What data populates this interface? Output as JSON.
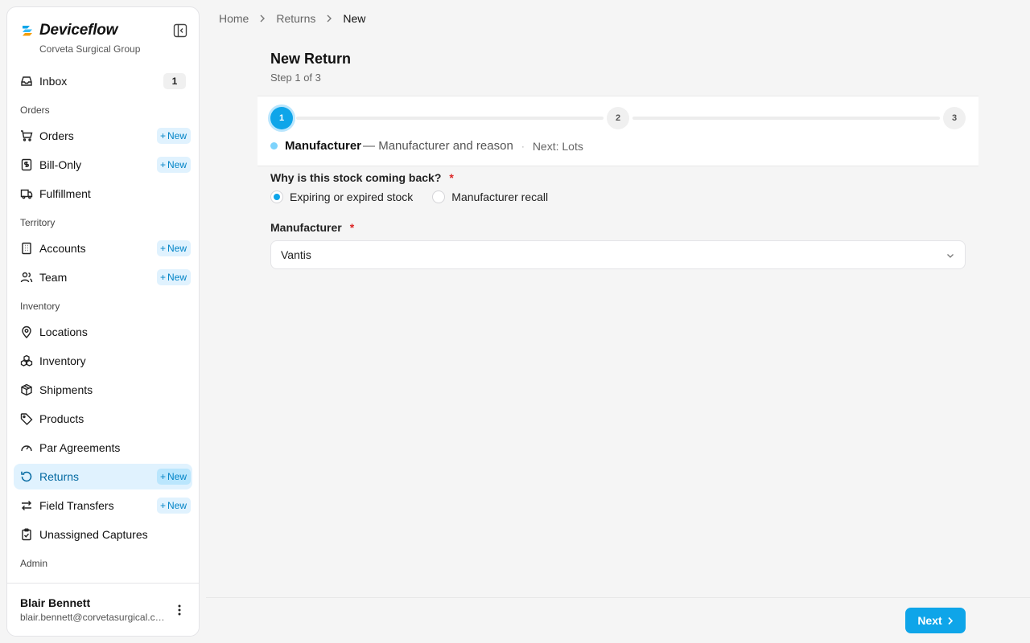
{
  "brand": {
    "name": "Deviceflow",
    "org": "Corveta Surgical Group"
  },
  "sidebar": {
    "inbox": {
      "label": "Inbox",
      "count": "1"
    },
    "sections": {
      "orders": "Orders",
      "territory": "Territory",
      "inventory": "Inventory",
      "admin": "Admin"
    },
    "items": {
      "orders": "Orders",
      "bill_only": "Bill-Only",
      "fulfillment": "Fulfillment",
      "accounts": "Accounts",
      "team": "Team",
      "locations": "Locations",
      "inventory": "Inventory",
      "shipments": "Shipments",
      "products": "Products",
      "par_agreements": "Par Agreements",
      "returns": "Returns",
      "field_transfers": "Field Transfers",
      "unassigned_captures": "Unassigned Captures"
    },
    "new_label": "New",
    "active_item": "Returns"
  },
  "user": {
    "name": "Blair Bennett",
    "email": "blair.bennett@corvetasurgical.com"
  },
  "breadcrumb": [
    "Home",
    "Returns",
    "New"
  ],
  "page": {
    "title": "New Return",
    "subtitle": "Step 1 of 3"
  },
  "stepper": {
    "steps": [
      "1",
      "2",
      "3"
    ],
    "current": {
      "name": "Manufacturer",
      "desc": "— Manufacturer and reason",
      "sep": "·",
      "next": "Next: Lots"
    }
  },
  "form": {
    "reason_label": "Why is this stock coming back?",
    "required_mark": "*",
    "reason_options": [
      "Expiring or expired stock",
      "Manufacturer recall"
    ],
    "reason_selected": "Expiring or expired stock",
    "manufacturer_label": "Manufacturer",
    "manufacturer_value": "Vantis"
  },
  "actions": {
    "next_label": "Next"
  },
  "colors": {
    "accent": "#0ea5e9",
    "active_bg": "#e0f2fe",
    "required": "#dc2626"
  }
}
